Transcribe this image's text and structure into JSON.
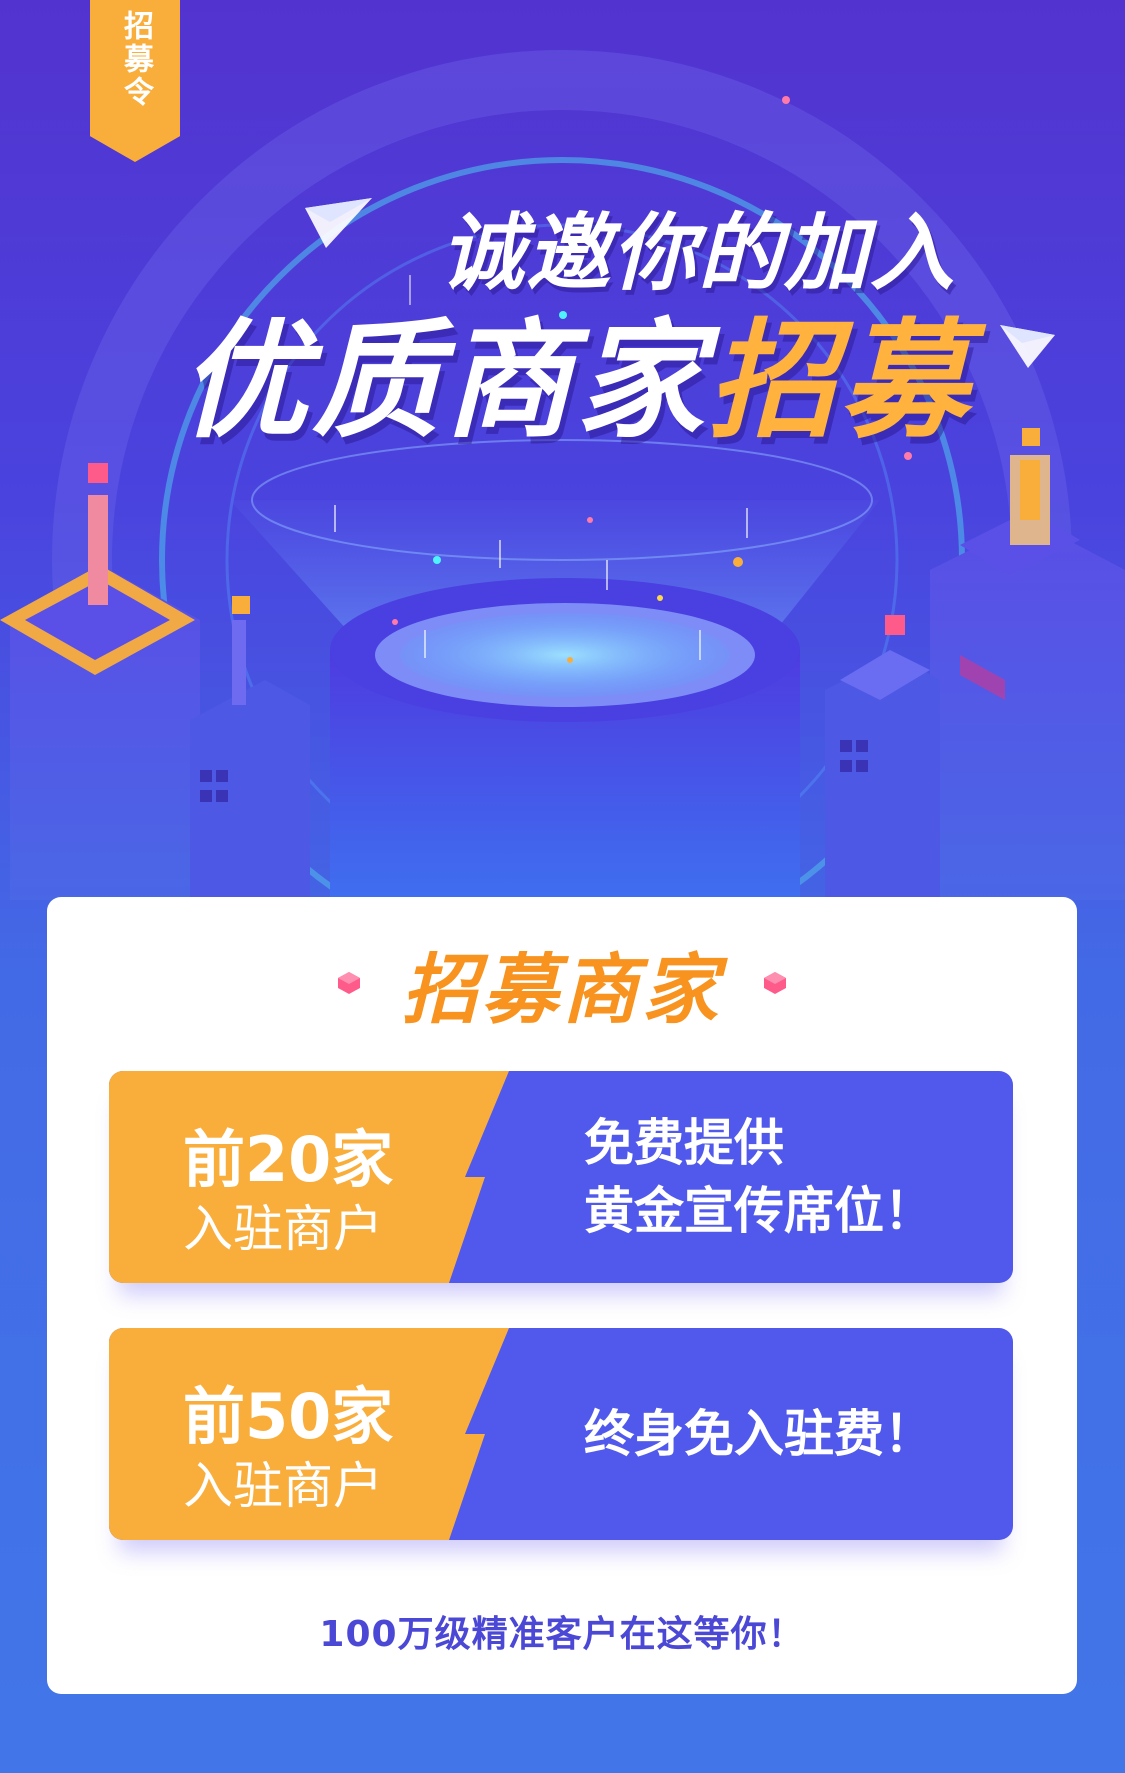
{
  "ribbon": {
    "label": "招募令"
  },
  "hero": {
    "subtitle": "诚邀你的加入",
    "title_white": "优质商家",
    "title_accent": "招募"
  },
  "card": {
    "title": "招募商家",
    "offers": [
      {
        "rank": "前20家",
        "sub": "入驻商户",
        "benefit_lines": [
          "免费提供",
          "黄金宣传席位！"
        ]
      },
      {
        "rank": "前50家",
        "sub": "入驻商户",
        "benefit_lines": [
          "终身免入驻费！"
        ]
      }
    ],
    "footer": "100万级精准客户在这等你！"
  },
  "colors": {
    "accent_orange": "#f9ae3c",
    "offer_blue": "#5059ec",
    "title_orange": "#f7931e",
    "background": "#4a43de"
  }
}
